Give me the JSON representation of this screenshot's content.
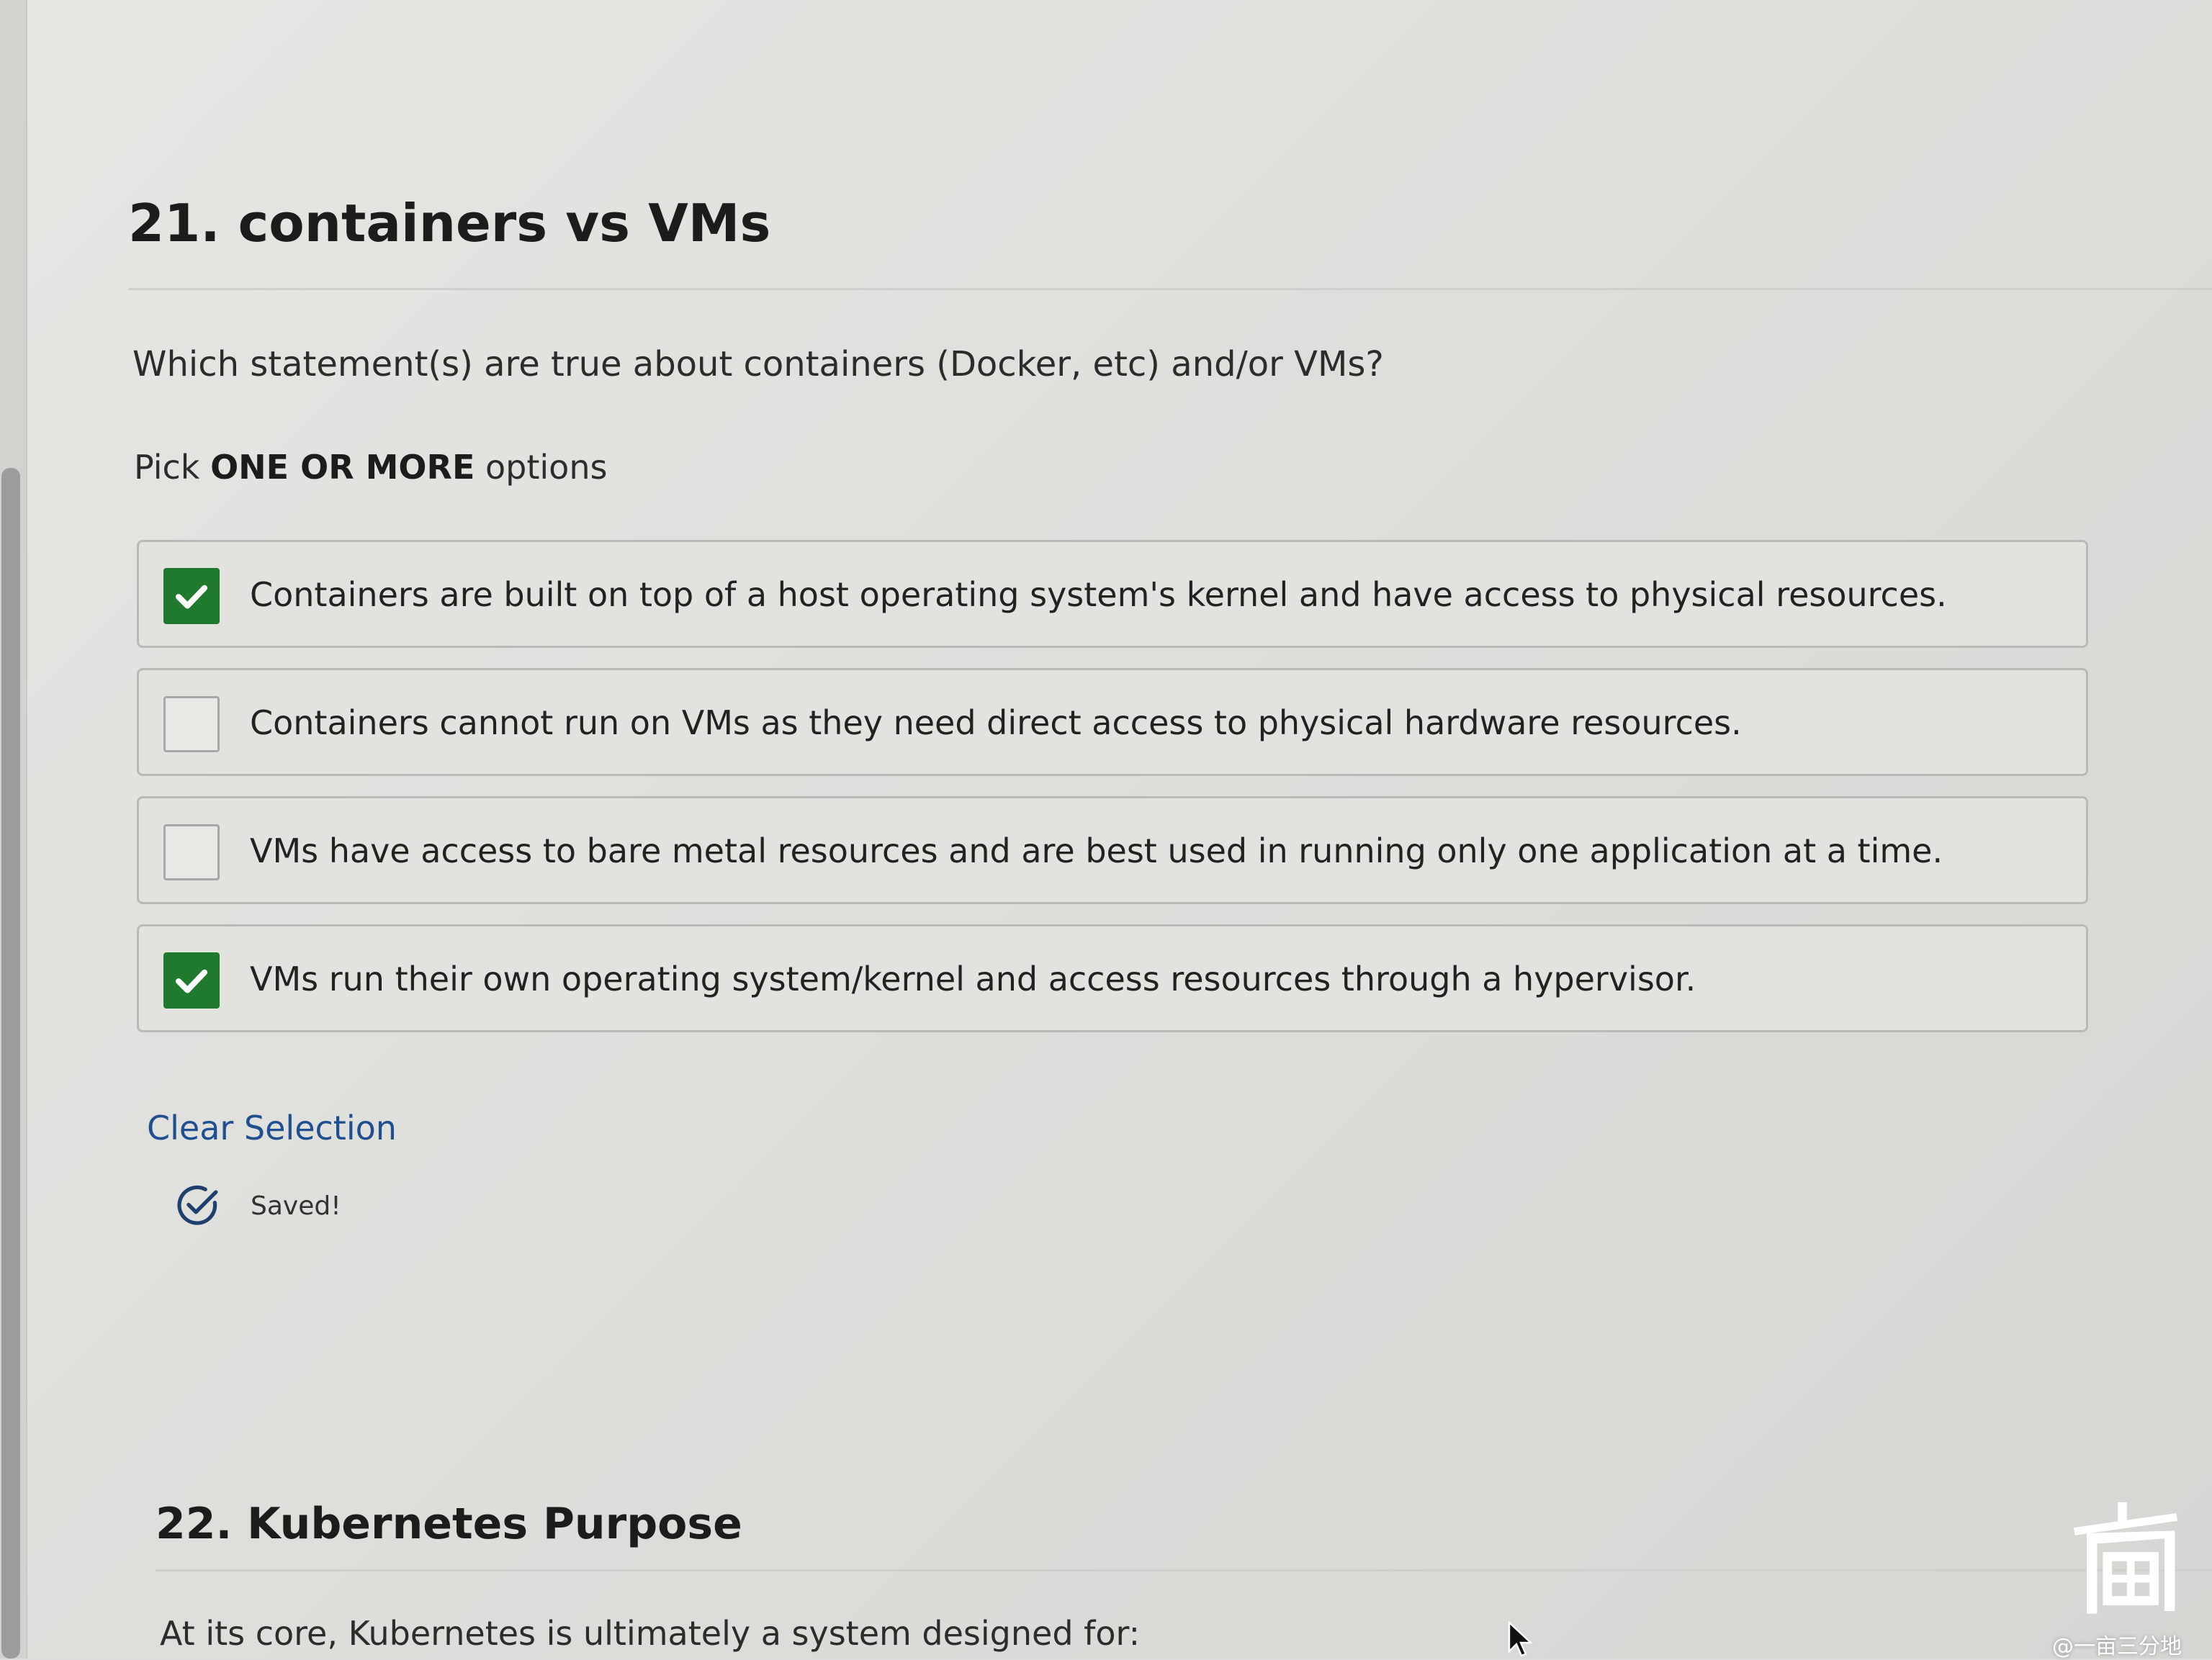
{
  "question": {
    "number_title": "21. containers vs VMs",
    "text": "Which statement(s) are true about containers (Docker, etc) and/or VMs?",
    "instruction_prefix": "Pick",
    "instruction_bold": "ONE OR MORE",
    "instruction_suffix": "options",
    "options": [
      {
        "label": "Containers are built on top of a host operating system's kernel and have access to physical resources.",
        "checked": true
      },
      {
        "label": "Containers cannot run on VMs as they need direct access to physical hardware resources.",
        "checked": false
      },
      {
        "label": "VMs have access to bare metal resources and are best used in running only one application at a time.",
        "checked": false
      },
      {
        "label": "VMs run their own operating system/kernel and access resources through a hypervisor.",
        "checked": true
      }
    ],
    "clear_selection_label": "Clear Selection",
    "saved_label": "Saved!"
  },
  "next_question": {
    "number_title": "22. Kubernetes Purpose",
    "text": "At its core, Kubernetes is ultimately a system designed for:"
  },
  "watermark": {
    "text": "@一亩三分地"
  },
  "colors": {
    "checked_green": "#1f7a2e",
    "link_blue": "#1f4f8f"
  },
  "icons": {
    "checkbox_checked": "checkmark-icon",
    "saved": "check-circle-icon",
    "cursor": "mouse-cursor-icon"
  }
}
